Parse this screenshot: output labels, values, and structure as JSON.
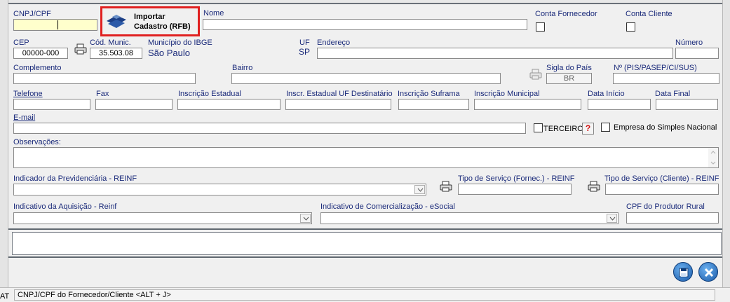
{
  "import_button": {
    "label_line1": "Importar",
    "label_line2": "Cadastro (RFB)"
  },
  "fields": {
    "cnpj_label": "CNPJ/CPF",
    "nome_label": "Nome",
    "conta_fornecedor_label": "Conta Fornecedor",
    "conta_cliente_label": "Conta Cliente",
    "cep_label": "CEP",
    "cep_value": "00000-000",
    "cod_munic_label": "Cód. Munic.",
    "cod_munic_value": "35.503.08",
    "municipio_label": "Município do IBGE",
    "municipio_value": "São Paulo",
    "uf_label": "UF",
    "uf_value": "SP",
    "endereco_label": "Endereço",
    "numero_label": "Número",
    "complemento_label": "Complemento",
    "bairro_label": "Bairro",
    "sigla_pais_label": "Sigla do País",
    "sigla_pais_value": "BR",
    "pis_label": "Nº (PIS/PASEP/CI/SUS)",
    "telefone_label": "Telefone",
    "fax_label": "Fax",
    "ie_label": "Inscrição Estadual",
    "ie_uf_dest_label": "Inscr. Estadual UF Destinatário",
    "suframa_label": "Inscrição Suframa",
    "im_label": "Inscrição Municipal",
    "data_inicio_label": "Data Início",
    "data_final_label": "Data Final",
    "email_label": "E-mail",
    "terceiro_label": "TERCEIRO",
    "help_label": "?",
    "simples_label": "Empresa do Simples Nacional",
    "observacoes_label": "Observações:",
    "ind_prev_label": "Indicador da Previdenciária - REINF",
    "tipo_serv_fornec_label": "Tipo de Serviço (Fornec.) - REINF",
    "tipo_serv_cliente_label": "Tipo de Serviço (Cliente) - REINF",
    "ind_aquisicao_label": "Indicativo da Aquisição - Reinf",
    "ind_comerc_label": "Indicativo de Comercialização - eSocial",
    "cpf_produtor_label": "CPF do Produtor Rural"
  },
  "status_bar": {
    "text": "CNPJ/CPF do Fornecedor/Cliente <ALT + J>",
    "left_fragment": "AT"
  },
  "colors": {
    "label": "#1a2a7a",
    "highlight_border": "#e02020",
    "cnpj_background": "#ffffcc"
  },
  "icons": [
    "rfb-logo-icon",
    "printer-icon",
    "save-icon",
    "close-icon",
    "chevron-down-icon"
  ]
}
